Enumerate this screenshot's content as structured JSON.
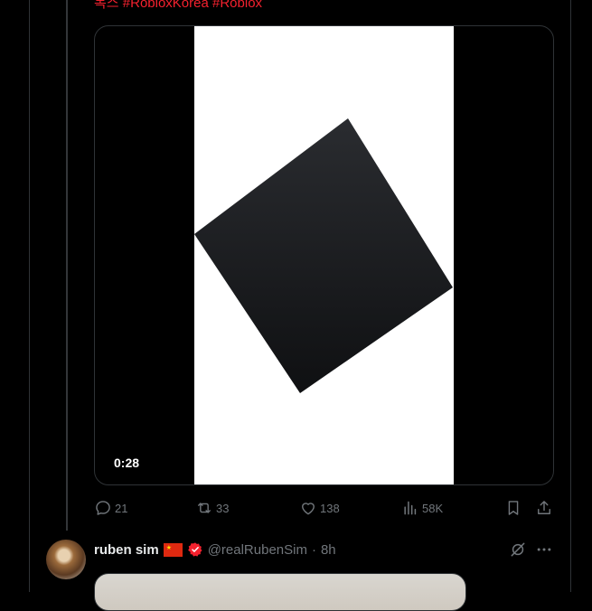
{
  "tweet": {
    "text_tail": "복스 #RobloxKorea #Roblox",
    "video": {
      "duration": "0:28"
    },
    "actions": {
      "replies": "21",
      "reposts": "33",
      "likes": "138",
      "views": "58K"
    }
  },
  "next_tweet": {
    "name": "ruben sim",
    "handle": "@realRubenSim",
    "separator": "·",
    "time": "8h",
    "flag_icon": "china-flag-icon",
    "verified_icon": "verified-badge-icon"
  },
  "colors": {
    "background": "#000000",
    "hashtag": "#f4212e",
    "muted": "#71767b",
    "verified": "#f4212e"
  }
}
